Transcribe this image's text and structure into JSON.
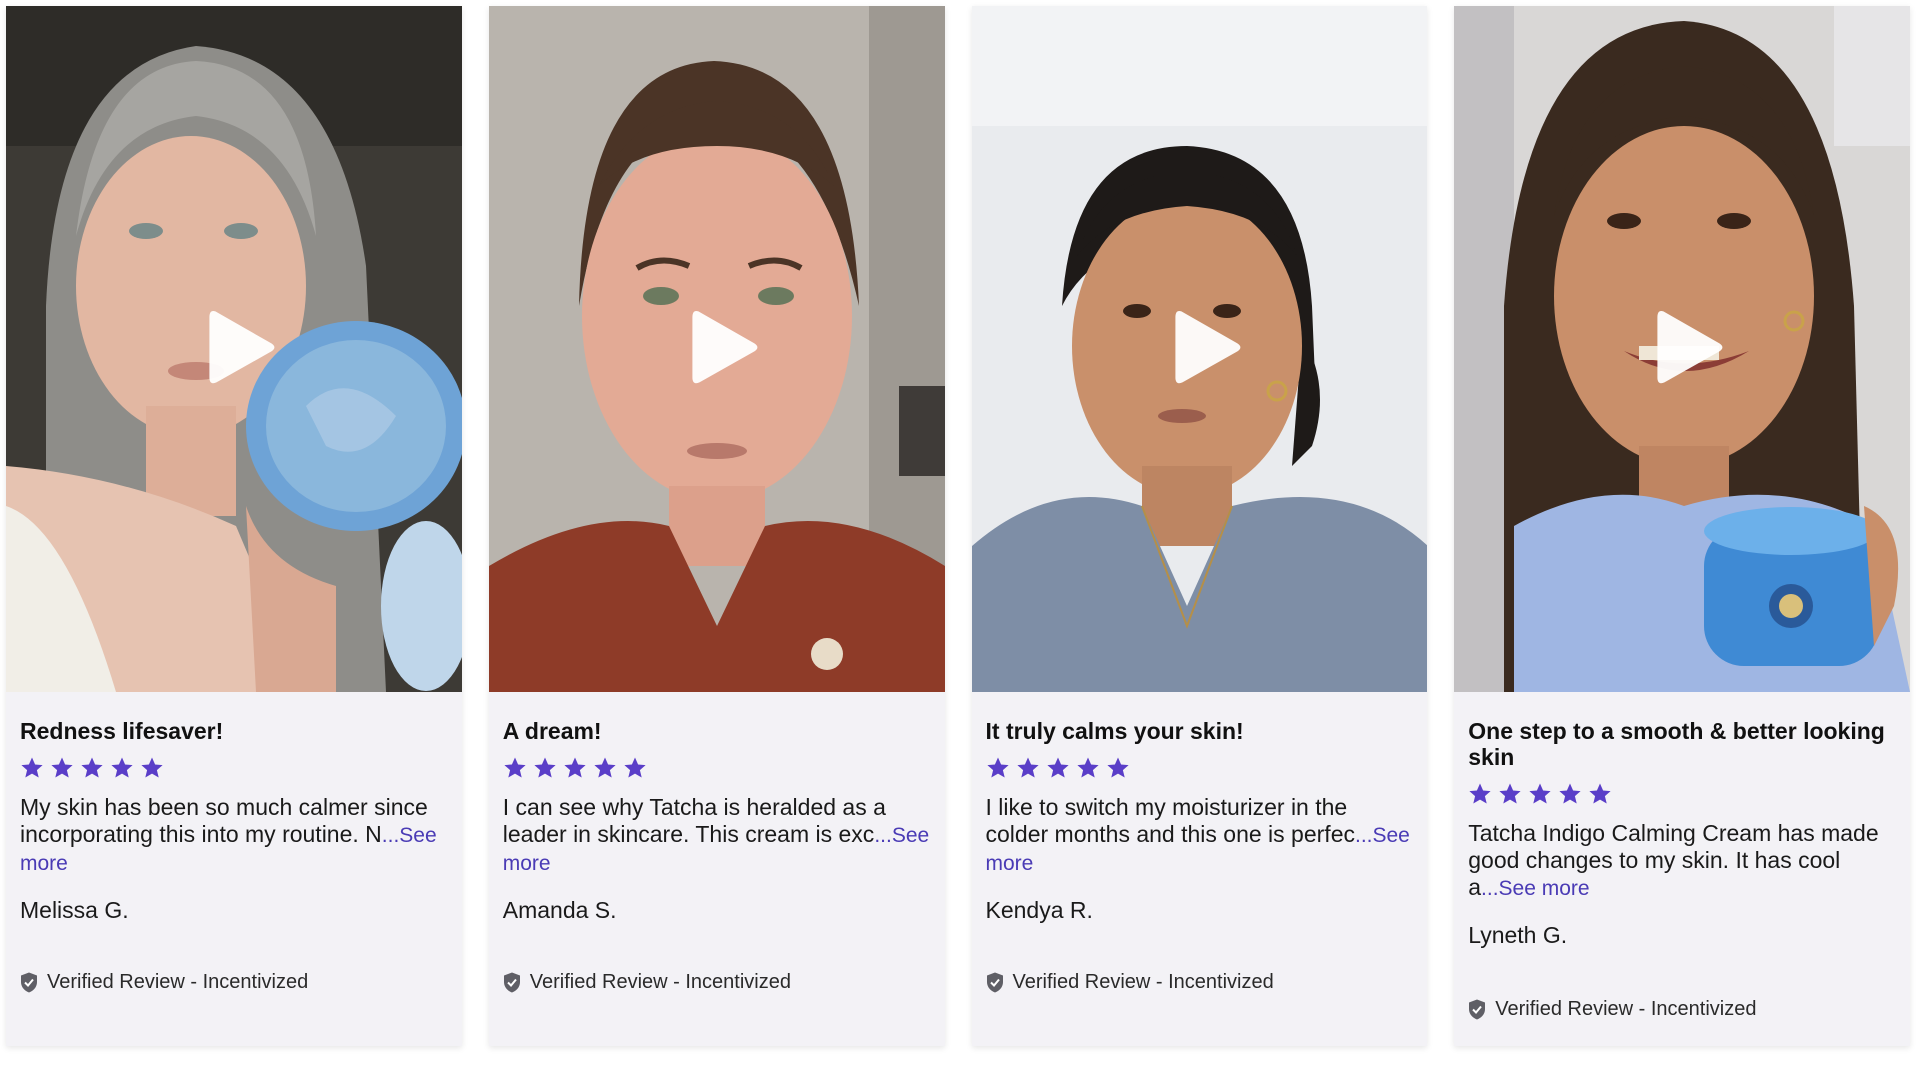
{
  "colors": {
    "star": "#5a3ec8",
    "see_more": "#4a3bb5",
    "card_bg": "#f3f2f6",
    "shield": "#5f5f66"
  },
  "icons": {
    "play": "play-icon",
    "star": "star-icon",
    "shield": "shield-check-icon"
  },
  "reviews": [
    {
      "title": "Redness lifesaver!",
      "rating": 5,
      "text": "My skin has been so much calmer since incorporating this into my routine. N",
      "see_more": "...See more",
      "author": "Melissa G.",
      "verified": "Verified Review - Incentivized"
    },
    {
      "title": "A dream!",
      "rating": 5,
      "text": "I can see why Tatcha is heralded as a leader in skincare. This cream is exc",
      "see_more": "...See more",
      "author": "Amanda S.",
      "verified": "Verified Review - Incentivized"
    },
    {
      "title": "It truly calms your skin!",
      "rating": 5,
      "text": "I like to switch my moisturizer in the colder months and this one is perfec",
      "see_more": "...See more",
      "author": "Kendya R.",
      "verified": "Verified Review - Incentivized"
    },
    {
      "title": "One step to a smooth & better looking skin",
      "rating": 5,
      "text": "Tatcha Indigo Calming Cream has made good changes to my skin. It has cool a",
      "see_more": "...See more",
      "author": "Lyneth G.",
      "verified": "Verified Review - Incentivized"
    }
  ]
}
